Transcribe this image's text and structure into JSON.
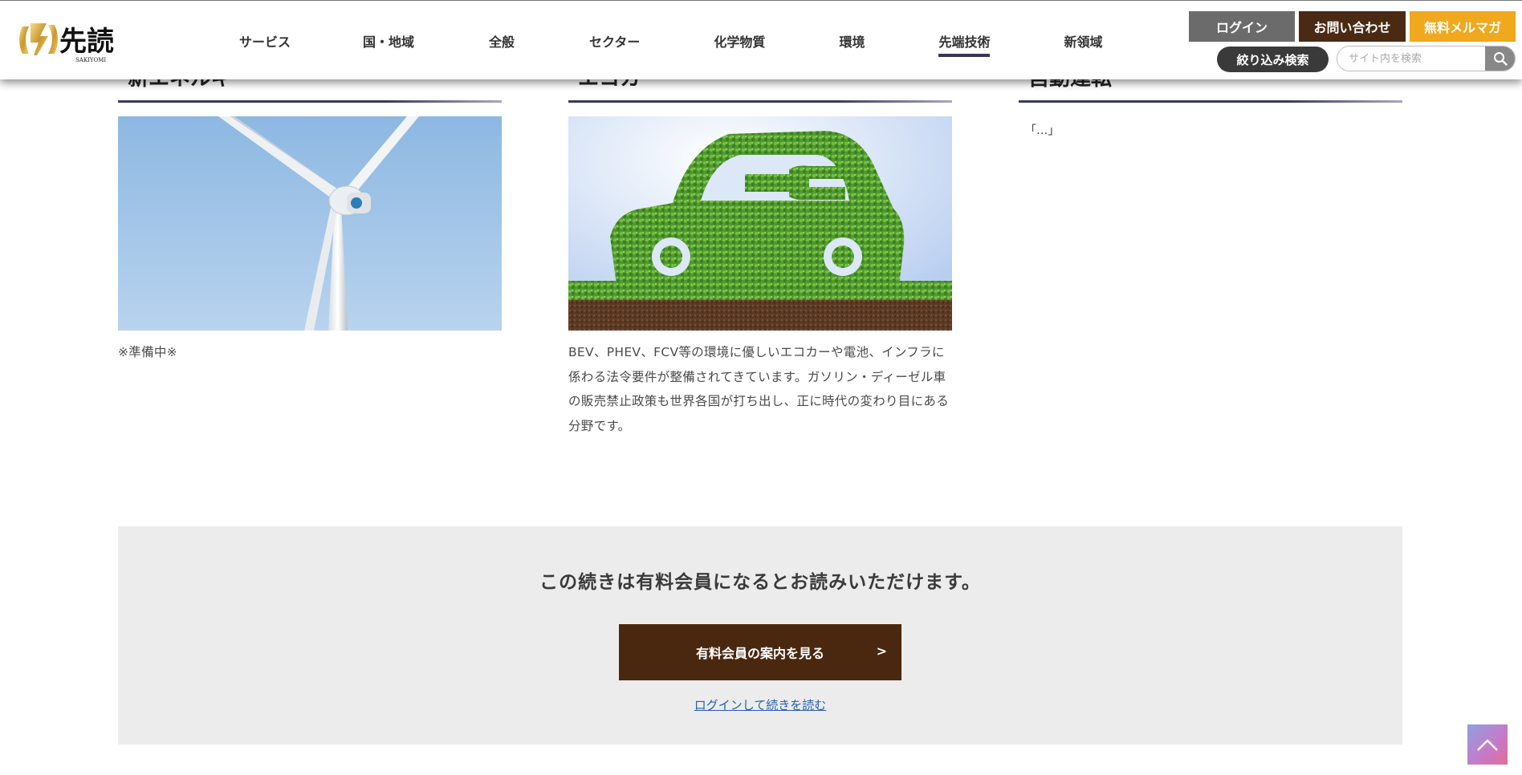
{
  "header": {
    "logo_text": "先読",
    "logo_sub": "SAKIYOMI",
    "nav": [
      {
        "label": "サービス"
      },
      {
        "label": "国・地域"
      },
      {
        "label": "全般"
      },
      {
        "label": "セクター"
      },
      {
        "label": "化学物質"
      },
      {
        "label": "環境"
      },
      {
        "label": "先端技術",
        "active": true
      },
      {
        "label": "新領域"
      }
    ],
    "login_label": "ログイン",
    "contact_label": "お問い合わせ",
    "newsletter_label": "無料メルマガ",
    "filter_label": "絞り込み検索",
    "search_placeholder": "サイト内を検索",
    "colors": {
      "login": "#6b6b6b",
      "contact": "#4a2a12",
      "newsletter": "#f0a81e"
    }
  },
  "columns": [
    {
      "heading": "新エネルギー",
      "image": "wind-turbine",
      "text": "※準備中※"
    },
    {
      "heading": "エコカー",
      "image": "green-eco-car",
      "text": "BEV、PHEV、FCV等の環境に優しいエコカーや電池、インフラに係わる法令要件が整備されてきています。ガソリン・ディーゼル車の販売禁止政策も世界各国が打ち出し、正に時代の変わり目にある分野です。"
    },
    {
      "heading": "自動運転",
      "image": null,
      "text": "「...」"
    }
  ],
  "paywall": {
    "message": "この続きは有料会員になるとお読みいただけます。",
    "button_label": "有料会員の案内を見る",
    "button_arrow": ">",
    "login_link": "ログインして続きを読む"
  },
  "to_top_icon": "chevron-up-icon"
}
